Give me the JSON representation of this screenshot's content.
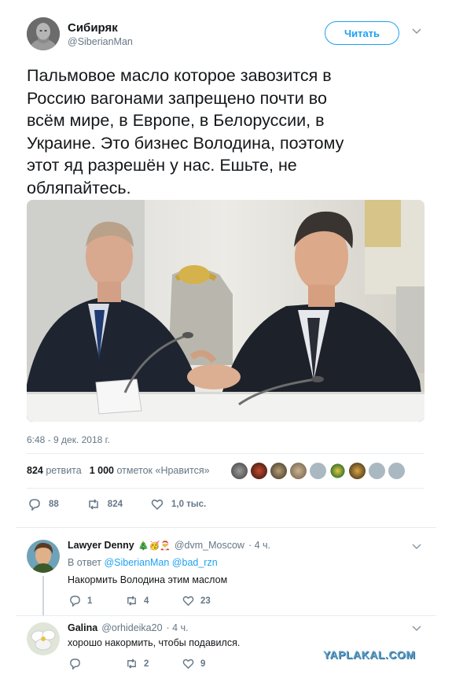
{
  "tweet": {
    "author_name": "Сибиряк",
    "author_handle": "@SiberianMan",
    "follow_label": "Читать",
    "text_lines": [
      "Пальмовое масло которое завозится в",
      "Россию вагонами запрещено почти во",
      "всём мире, в Европе, в Белоруссии, в",
      "Украине. Это бизнес Володина, поэтому",
      "этот яд разрешён у нас.  Ешьте, не",
      "обляпайтесь."
    ],
    "timestamp": "6:48 - 9 дек. 2018 г.",
    "retweets_count": "824",
    "retweets_label": "ретвита",
    "likes_count": "1 000",
    "likes_label": "отметок «Нравится»",
    "actions": {
      "replies": "88",
      "retweets": "824",
      "likes": "1,0 тыс."
    }
  },
  "replies": [
    {
      "name": "Lawyer Denny",
      "emojis": "🎄🥳🎅",
      "handle": "@dvm_Moscow",
      "time": "· 4 ч.",
      "in_reply_prefix": "В ответ",
      "in_reply_users": "@SiberianMan @bad_rzn",
      "text": "Накормить Володина этим маслом",
      "actions": {
        "replies": "1",
        "retweets": "4",
        "likes": "23"
      }
    },
    {
      "name": "Galina",
      "handle": "@orhideika20",
      "time": "· 4 ч.",
      "text": "хорошо накормить, чтобы подавился.",
      "actions": {
        "replies": "",
        "retweets": "2",
        "likes": "9"
      }
    }
  ],
  "watermark": "YAPLAKAL.COM",
  "colors": {
    "accent": "#1da1f2",
    "secondary_text": "#657786",
    "primary_text": "#14171a"
  }
}
